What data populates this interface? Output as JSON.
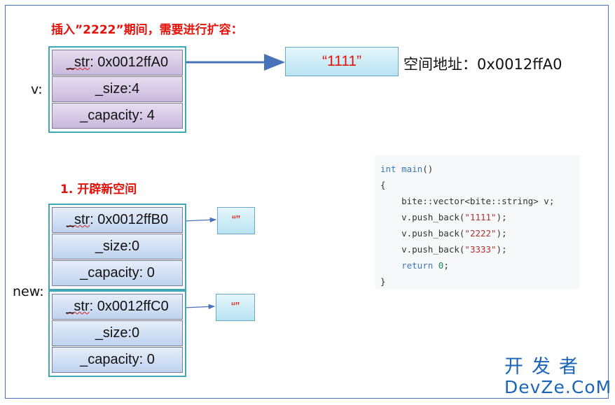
{
  "heading_top": "插入”2222”期间，需要进行扩容：",
  "heading_step": "1. 开辟新空间",
  "var_v": "v:",
  "var_new": "new:",
  "struct_v": {
    "str_label": "_str",
    "str_value": ": 0x0012ffA0",
    "size": "_size:4",
    "capacity": "_capacity: 4"
  },
  "struct_new1": {
    "str_label": "_str",
    "str_value": ": 0x0012ffB0",
    "size": "_size:0",
    "capacity": "_capacity: 0"
  },
  "struct_new2": {
    "str_label": "_str",
    "str_value": ": 0x0012ffC0",
    "size": "_size:0",
    "capacity": "_capacity: 0"
  },
  "string_v": "“1111”",
  "string_new1": "“”",
  "string_new2": "“”",
  "address_label": "空间地址：0x0012ffA0",
  "code": {
    "l1_kw": "int",
    "l1_fn": "main",
    "l1_rest": "()",
    "l2": "{",
    "l3": "    bite::vector<bite::string> v;",
    "l4_pre": "    v.push_back(",
    "l4_str": "\"1111\"",
    "l4_post": ");",
    "l5_pre": "    v.push_back(",
    "l5_str": "\"2222\"",
    "l5_post": ");",
    "l6_pre": "    v.push_back(",
    "l6_str": "\"3333\"",
    "l6_post": ");",
    "l7_kw": "    return",
    "l7_num": "0",
    "l7_post": ";",
    "l8": "}"
  },
  "watermark": {
    "cn": "开发者",
    "en": "DevZe.CoM"
  },
  "colors": {
    "heading": "#e3120b",
    "struct_border": "#3fa7b5",
    "arrow": "#4a72b8",
    "brand": "#1a65b8"
  }
}
